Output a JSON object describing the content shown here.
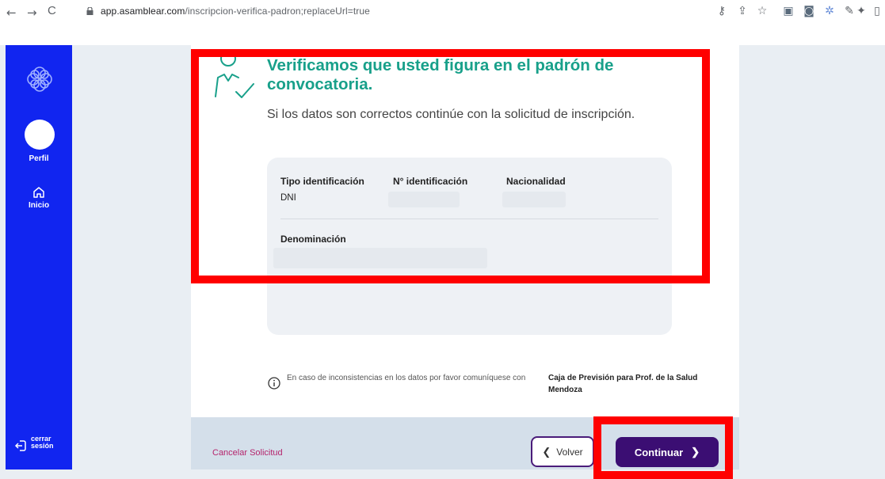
{
  "browser": {
    "back_glyph": "←",
    "forward_glyph": "→",
    "reload_glyph": "C",
    "url_host": "app.asamblear.com",
    "url_path": "/inscripcion-verifica-padron;replaceUrl=true"
  },
  "sidebar": {
    "profile_label": "Perfil",
    "home_label": "Inicio",
    "logout_label_1": "cerrar",
    "logout_label_2": "sesión",
    "color": "#1125f0"
  },
  "main": {
    "title": "Verificamos que usted figura en el padrón de convocatoria.",
    "subtitle": "Si los datos son correctos continúe con la solicitud de inscripción.",
    "card": {
      "tipo_header": "Tipo identificación",
      "tipo_value": "DNI",
      "numero_header": "N° identificación",
      "nacionalidad_header": "Nacionalidad",
      "denominacion_header": "Denominación"
    },
    "info_text": "En caso de inconsistencias en los datos por favor comuníquese con",
    "info_org": "Caja de Previsión para Prof. de la Salud Mendoza"
  },
  "footer": {
    "cancel_label": "Cancelar Solicitud",
    "back_label": "Volver",
    "continue_label": "Continuar"
  },
  "colors": {
    "accent_title": "#18a08a",
    "primary_button": "#3b0e73",
    "cancel_link": "#b5246c",
    "highlight": "#ff0000"
  }
}
